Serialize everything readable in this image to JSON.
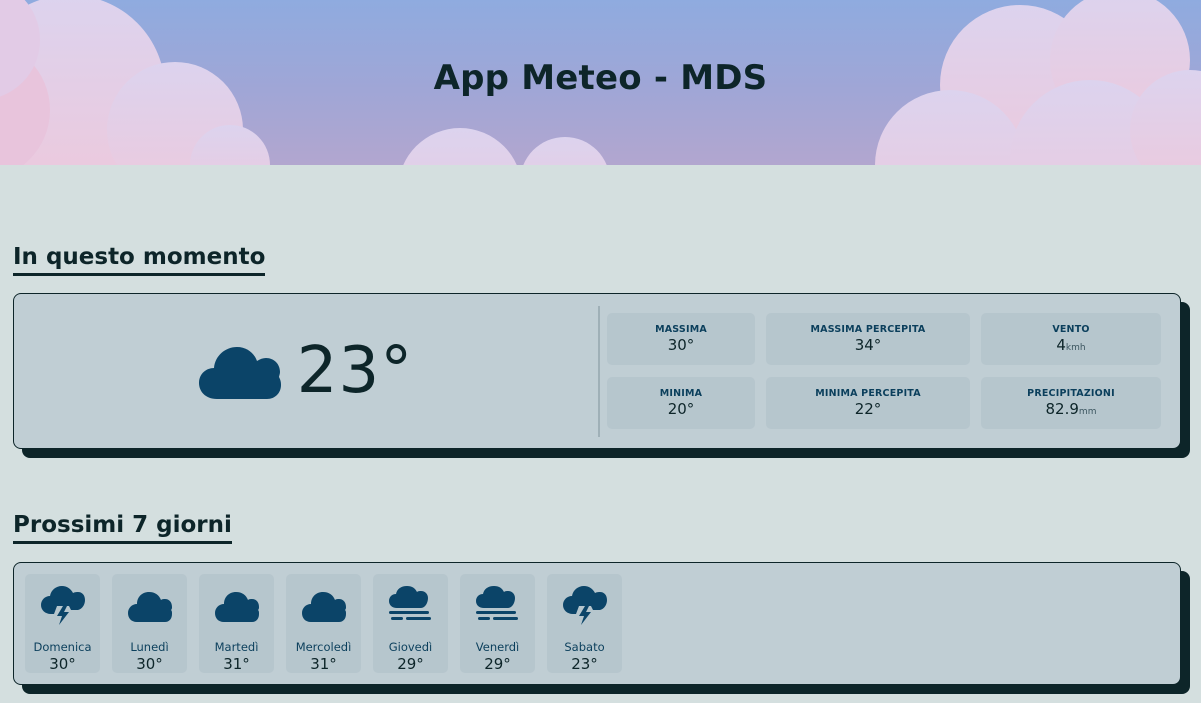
{
  "app": {
    "title": "App Meteo - MDS"
  },
  "current": {
    "section_title": "In questo momento",
    "icon": "cloud-icon",
    "temperature": "23°",
    "stats": {
      "max": {
        "label": "MASSIMA",
        "value": "30°"
      },
      "max_feels": {
        "label": "MASSIMA PERCEPITA",
        "value": "34°"
      },
      "wind": {
        "label": "VENTO",
        "value": "4",
        "unit": "kmh"
      },
      "min": {
        "label": "MINIMA",
        "value": "20°"
      },
      "min_feels": {
        "label": "MINIMA PERCEPITA",
        "value": "22°"
      },
      "precip": {
        "label": "PRECIPITAZIONI",
        "value": "82.9",
        "unit": "mm"
      }
    }
  },
  "forecast": {
    "section_title": "Prossimi 7 giorni",
    "days": [
      {
        "name": "Domenica",
        "temp": "30°",
        "icon": "thunderstorm-icon"
      },
      {
        "name": "Lunedì",
        "temp": "30°",
        "icon": "cloud-icon"
      },
      {
        "name": "Martedì",
        "temp": "31°",
        "icon": "cloud-icon"
      },
      {
        "name": "Mercoledì",
        "temp": "31°",
        "icon": "cloud-icon"
      },
      {
        "name": "Giovedì",
        "temp": "29°",
        "icon": "fog-icon"
      },
      {
        "name": "Venerdì",
        "temp": "29°",
        "icon": "fog-icon"
      },
      {
        "name": "Sabato",
        "temp": "23°",
        "icon": "thunderstorm-icon"
      }
    ]
  },
  "colors": {
    "background": "#d4dfdf",
    "card": "#c0ced4",
    "tile": "#b6c6cd",
    "icon": "#0b4468",
    "text": "#0d2529"
  }
}
